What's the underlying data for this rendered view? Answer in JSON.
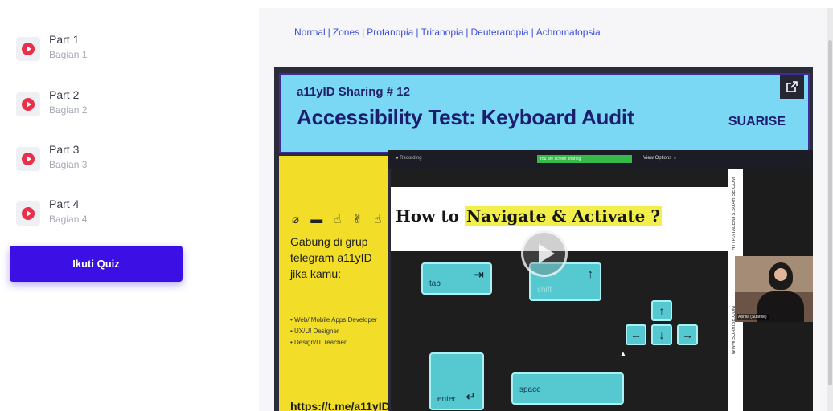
{
  "sidebar": {
    "parts": [
      {
        "title": "Part 1",
        "subtitle": "Bagian 1"
      },
      {
        "title": "Part 2",
        "subtitle": "Bagian 2"
      },
      {
        "title": "Part 3",
        "subtitle": "Bagian 3"
      },
      {
        "title": "Part 4",
        "subtitle": "Bagian 4"
      }
    ],
    "quiz_button": "Ikuti Quiz"
  },
  "main": {
    "color_modes": [
      "Normal",
      "Zones",
      "Protanopia",
      "Tritanopia",
      "Deuteranopia",
      "Achromatopsia"
    ],
    "separator": "|"
  },
  "video": {
    "tag": "a11yID Sharing # 12",
    "title": "Accessibility Test: Keyboard Audit",
    "brand": "SUARISE",
    "left_panel": {
      "icons": "⌀ ▬ ☝ ✌ ☝",
      "join_text": "Gabung di grup telegram a11yID jika kamu:",
      "bullets": [
        "• Web/ Mobile Apps Developer",
        "• UX/UI Designer",
        "• Design/IT Teacher"
      ],
      "link_cut": "https://t.me/a11yID"
    },
    "zoom_bar": {
      "recording": "● Recording",
      "share_notice": "You are screen sharing",
      "options": "View Options ⌄"
    },
    "slide": {
      "howto_prefix": "How to ",
      "howto_highlight": "Navigate & Activate ?",
      "keys": {
        "tab": "tab",
        "shift": "shift",
        "enter": "enter",
        "space": "space"
      },
      "side_text_1": "HTTP://TALENTS.SUARISE.COM",
      "side_text_2": "WWW.SUARISE.COM",
      "side_brand": "SUARISE"
    },
    "participant_name": "Aprilia (Suarise)"
  },
  "colors": {
    "quiz_button": "#3a10e5",
    "link": "#3a4fd8",
    "play_icon": "#e8304a",
    "banner": "#7ad8f5",
    "yellow_panel": "#f2de28",
    "key": "#56c9d0"
  }
}
